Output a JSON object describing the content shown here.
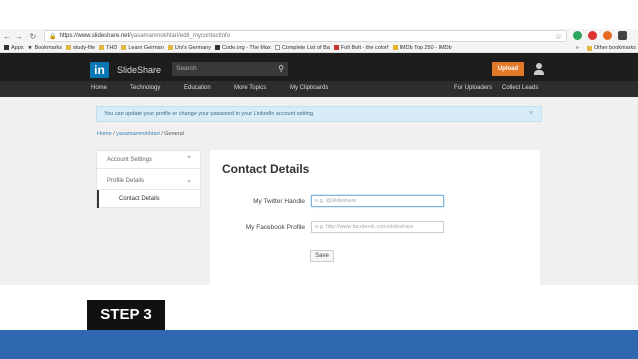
{
  "browser": {
    "url_host": "https://www.slideshare.net/",
    "url_path": "yasamanmokhtari/edit_mycontactinfo",
    "bookmarks": [
      {
        "label": "Apps",
        "icon": "apps-grid-icon"
      },
      {
        "label": "Bookmarks",
        "icon": "star-icon"
      },
      {
        "label": "study-file",
        "icon": "folder-icon"
      },
      {
        "label": "THD",
        "icon": "folder-icon"
      },
      {
        "label": "Learn German",
        "icon": "folder-icon"
      },
      {
        "label": "Uni's Germany",
        "icon": "folder-icon"
      },
      {
        "label": "Code.org - The Max",
        "icon": "code-org-icon"
      },
      {
        "label": "Complete List of Ba",
        "icon": "page-icon"
      },
      {
        "label": "Folt Bolt - the colorf",
        "icon": "folt-bolt-icon"
      },
      {
        "label": "IMDb Top 250 - IMDb",
        "icon": "imdb-icon"
      }
    ],
    "other_bookmarks": "Other bookmarks"
  },
  "header": {
    "logo_mark": "in",
    "logo_text": "SlideShare",
    "search_placeholder": "Search",
    "upload_label": "Upload"
  },
  "nav": {
    "left": [
      "Home",
      "Technology",
      "Education",
      "More Topics",
      "My Clipboards"
    ],
    "right": [
      "For Uploaders",
      "Collect Leads"
    ]
  },
  "notice": {
    "text": "You can update your profile or change your password in your LinkedIn account setting.",
    "close": "×"
  },
  "breadcrumb": {
    "home": "Home",
    "sep": "/",
    "user": "yasamanmokhtari",
    "current": "General"
  },
  "sidebar": {
    "account_settings": "Account Settings",
    "profile_details": "Profile Details",
    "contact_details": "Contact Details"
  },
  "main": {
    "title": "Contact Details",
    "twitter_label": "My Twitter Handle",
    "twitter_placeholder": "e.g. @slideshare",
    "facebook_label": "My Facebook Profile",
    "facebook_placeholder": "e.g. http://www.facebook.com/slideshare",
    "save_label": "Save"
  },
  "overlay": {
    "step_label": "STEP 3"
  },
  "colors": {
    "linkedin_blue": "#0a77b5",
    "upload_orange": "#e37a29",
    "bottom_bar": "#2f67b0"
  }
}
